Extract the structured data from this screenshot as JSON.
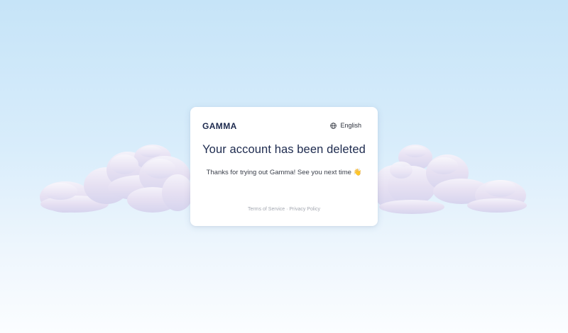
{
  "brand": {
    "logo_text": "GAMMA"
  },
  "header": {
    "language_label": "English",
    "language_icon": "globe-icon"
  },
  "main": {
    "title": "Your account has been deleted",
    "message": "Thanks for trying out Gamma! See you next time 👋"
  },
  "footer": {
    "terms_label": "Terms of Service",
    "separator": "·",
    "privacy_label": "Privacy Policy"
  },
  "colors": {
    "brand_navy": "#1d2a4e",
    "sky_top": "#c6e4f8",
    "sky_bottom": "#fbfdff"
  }
}
